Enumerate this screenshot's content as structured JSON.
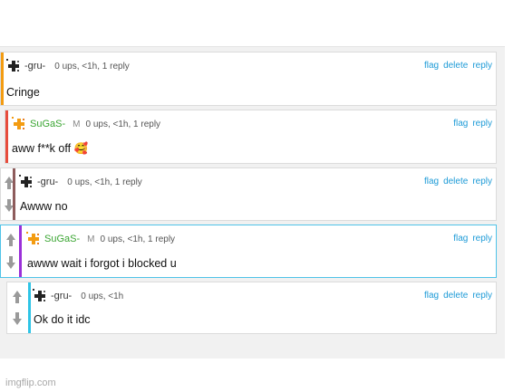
{
  "comments": [
    {
      "user": "-gru-",
      "mod_badge": "",
      "meta": "0 ups, <1h, 1 reply",
      "text": "Cringe",
      "actions": {
        "flag": "flag",
        "delete": "delete",
        "reply": "reply"
      },
      "bar_color": "#f39c12"
    },
    {
      "user": "SuGaS-",
      "mod_badge": "M",
      "meta": "0 ups, <1h, 1 reply",
      "text": "aww f**k off 🥰",
      "actions": {
        "flag": "flag",
        "reply": "reply"
      },
      "bar_color": "#e74c3c"
    },
    {
      "user": "-gru-",
      "mod_badge": "",
      "meta": "0 ups, <1h, 1 reply",
      "text": "Awww no",
      "actions": {
        "flag": "flag",
        "delete": "delete",
        "reply": "reply"
      },
      "bar_color": "#8e5c5c"
    },
    {
      "user": "SuGaS-",
      "mod_badge": "M",
      "meta": "0 ups, <1h, 1 reply",
      "text": "awww wait i forgot i blocked u",
      "actions": {
        "flag": "flag",
        "reply": "reply"
      },
      "bar_color": "#9b30d9"
    },
    {
      "user": "-gru-",
      "mod_badge": "",
      "meta": "0 ups, <1h",
      "text": "Ok do it idc",
      "actions": {
        "flag": "flag",
        "delete": "delete",
        "reply": "reply"
      },
      "bar_color": "#2ec4e6"
    }
  ],
  "watermark": "imgflip.com",
  "icons": {
    "upvote": "upvote-arrow-icon",
    "downvote": "downvote-arrow-icon",
    "avatar": "pixel-avatar-icon"
  },
  "colors": {
    "link": "#1e9bd7",
    "mod_name": "#3aa532",
    "highlight_border": "#4fc3e8"
  }
}
